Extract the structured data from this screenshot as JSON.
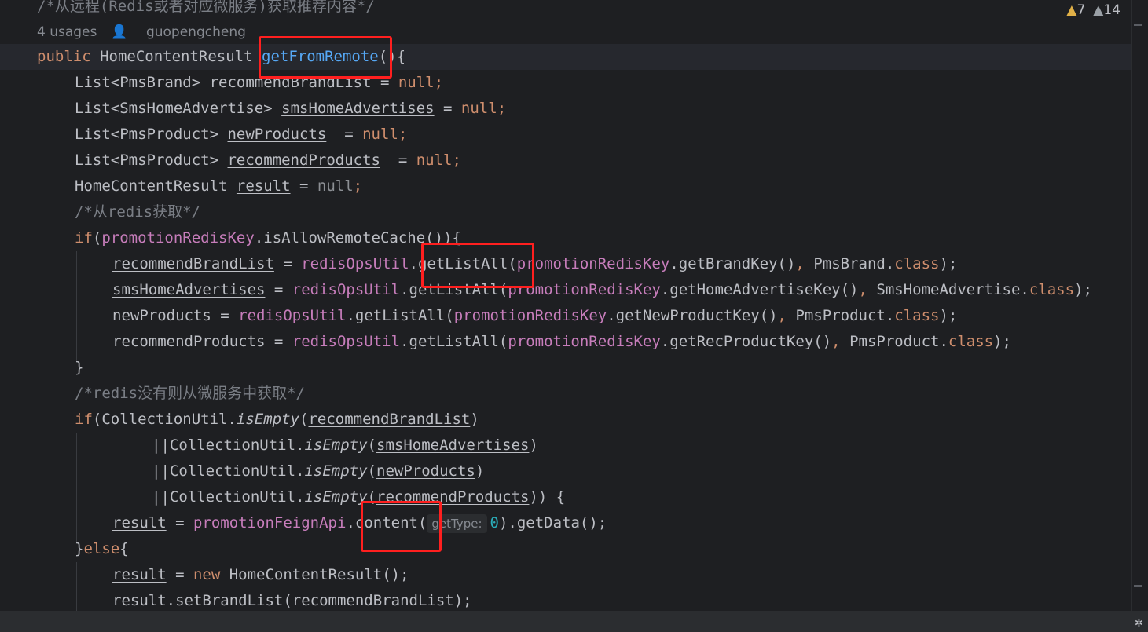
{
  "inspections": {
    "warnings": "7",
    "weak_warnings": "14"
  },
  "meta": {
    "usages": "4 usages",
    "author": "guopengcheng"
  },
  "code": {
    "l0_comment": "/*从远程(Redis或者对应微服务)获取推荐内容*/",
    "l1": {
      "public": "public",
      "type": "HomeContentResult",
      "method": "getFromRemote",
      "tail": "(){"
    },
    "l2": {
      "type": "List<PmsBrand>",
      "var": "recommendBrandList",
      "eq": " = ",
      "null": "null",
      "semi": ";"
    },
    "l3": {
      "type": "List<SmsHomeAdvertise>",
      "var": "smsHomeAdvertises",
      "eq": " = ",
      "null": "null",
      "semi": ";"
    },
    "l4": {
      "type": "List<PmsProduct>",
      "var": "newProducts",
      "eq": "  = ",
      "null": "null",
      "semi": ";"
    },
    "l5": {
      "type": "List<PmsProduct>",
      "var": "recommendProducts",
      "eq": "  = ",
      "null": "null",
      "semi": ";"
    },
    "l6": {
      "type": "HomeContentResult",
      "var": "result",
      "eq": " = ",
      "null": "null",
      "semi": ";"
    },
    "l7_comment": "/*从redis获取*/",
    "l8": {
      "if": "if",
      "open": "(",
      "field": "promotionRedisKey",
      "call": ".isAllowRemoteCache()){"
    },
    "l9": {
      "var": "recommendBrandList",
      "eq": " = ",
      "util": "redisOpsUtil",
      "call": ".getListAll(",
      "key": "promotionRedisKey",
      "getter": ".getBrandKey()",
      "comma": ", ",
      "cls": "PmsBrand.",
      "class": "class",
      "end": ");"
    },
    "l10": {
      "var": "smsHomeAdvertises",
      "eq": " = ",
      "util": "redisOpsUtil",
      "call": ".getListAll(",
      "key": "promotionRedisKey",
      "getter": ".getHomeAdvertiseKey()",
      "comma": ", ",
      "cls": "SmsHomeAdvertise.",
      "class": "class",
      "end": ");"
    },
    "l11": {
      "var": "newProducts",
      "eq": " = ",
      "util": "redisOpsUtil",
      "call": ".getListAll(",
      "key": "promotionRedisKey",
      "getter": ".getNewProductKey()",
      "comma": ", ",
      "cls": "PmsProduct.",
      "class": "class",
      "end": ");"
    },
    "l12": {
      "var": "recommendProducts",
      "eq": " = ",
      "util": "redisOpsUtil",
      "call": ".getListAll(",
      "key": "promotionRedisKey",
      "getter": ".getRecProductKey()",
      "comma": ", ",
      "cls": "PmsProduct.",
      "class": "class",
      "end": ");"
    },
    "l13": "}",
    "l14_comment": "/*redis没有则从微服务中获取*/",
    "l15": {
      "if": "if",
      "open": "(CollectionUtil.",
      "fn": "isEmpty",
      "p1": "(",
      "var": "recommendBrandList",
      "p2": ")"
    },
    "l16": {
      "pre": "||CollectionUtil.",
      "fn": "isEmpty",
      "p1": "(",
      "var": "smsHomeAdvertises",
      "p2": ")"
    },
    "l17": {
      "pre": "||CollectionUtil.",
      "fn": "isEmpty",
      "p1": "(",
      "var": "newProducts",
      "p2": ")"
    },
    "l18": {
      "pre": "||CollectionUtil.",
      "fn": "isEmpty",
      "p1": "(",
      "var": "recommendProducts",
      "p2": ")) {"
    },
    "l19": {
      "var": "result",
      "eq": " = ",
      "field": "promotionFeignApi",
      "call": ".content(",
      "hint": "getType:",
      "num": "0",
      "end": ").getData();"
    },
    "l20": {
      "brace": "}",
      "else": "else",
      "open": "{"
    },
    "l21": {
      "var": "result",
      "eq": " = ",
      "new": "new",
      "rest": " HomeContentResult();"
    },
    "l22": {
      "var": "result",
      "call": ".setBrandList(",
      "arg": "recommendBrandList",
      "end": ");"
    }
  }
}
